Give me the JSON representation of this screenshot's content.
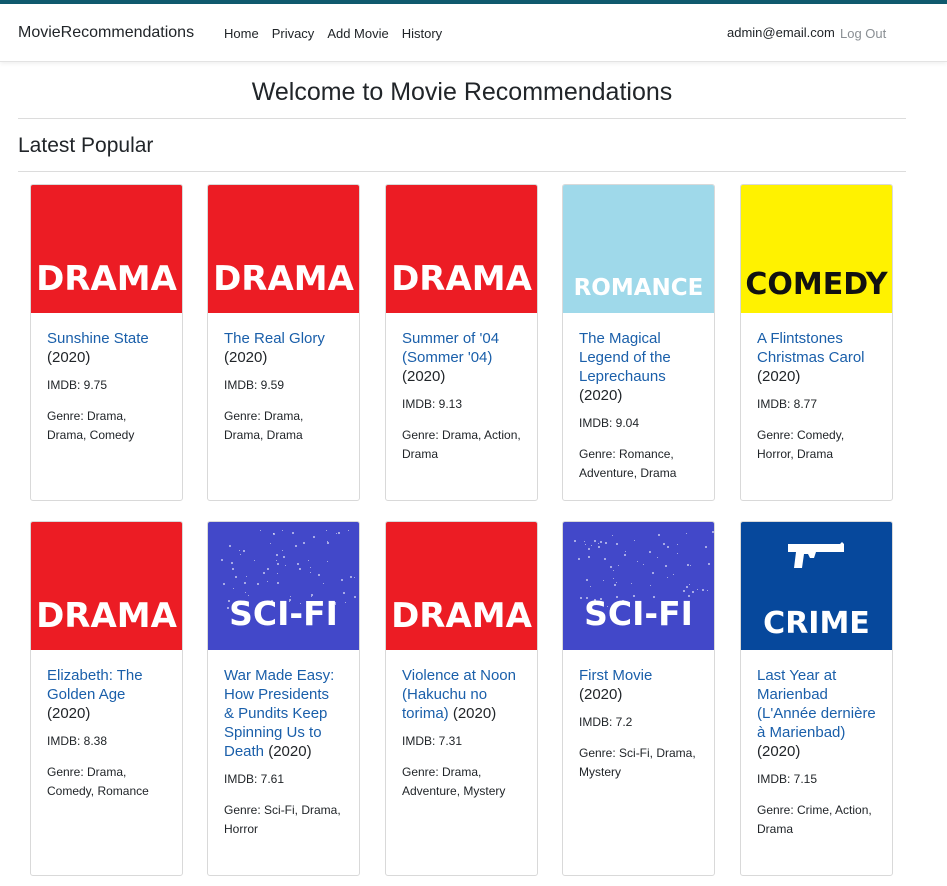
{
  "nav": {
    "brand": "MovieRecommendations",
    "links": [
      "Home",
      "Privacy",
      "Add Movie",
      "History"
    ],
    "user_email": "admin@email.com",
    "logout": "Log Out"
  },
  "page": {
    "welcome": "Welcome to Movie Recommendations",
    "section_title": "Latest Popular"
  },
  "colors": {
    "drama": "#ec1c24",
    "romance": "#9fd9ea",
    "comedy": "#fff200",
    "scifi": "#4248c9",
    "crime": "#06489c",
    "link": "#1a5faa"
  },
  "movies": [
    {
      "poster": "DRAMA",
      "title": "Sunshine State",
      "year": "(2020)",
      "imdb": "IMDB: 9.75",
      "genre": "Genre: Drama, Drama, Comedy"
    },
    {
      "poster": "DRAMA",
      "title": "The Real Glory",
      "year": "(2020)",
      "imdb": "IMDB: 9.59",
      "genre": "Genre: Drama, Drama, Drama"
    },
    {
      "poster": "DRAMA",
      "title": "Summer of '04 (Sommer '04)",
      "year": "(2020)",
      "imdb": "IMDB: 9.13",
      "genre": "Genre: Drama, Action, Drama"
    },
    {
      "poster": "ROMANCE",
      "title": "The Magical Legend of the Leprechauns",
      "year": "(2020)",
      "imdb": "IMDB: 9.04",
      "genre": "Genre: Romance, Adventure, Drama"
    },
    {
      "poster": "COMEDY",
      "title": "A Flintstones Christmas Carol",
      "year": "(2020)",
      "imdb": "IMDB: 8.77",
      "genre": "Genre: Comedy, Horror, Drama"
    },
    {
      "poster": "DRAMA",
      "title": "Elizabeth: The Golden Age",
      "year": "(2020)",
      "imdb": "IMDB: 8.38",
      "genre": "Genre: Drama, Comedy, Romance"
    },
    {
      "poster": "SCI-FI",
      "title": "War Made Easy: How Presidents & Pundits Keep Spinning Us to Death",
      "year": "(2020)",
      "imdb": "IMDB: 7.61",
      "genre": "Genre: Sci-Fi, Drama, Horror"
    },
    {
      "poster": "DRAMA",
      "title": "Violence at Noon (Hakuchu no torima)",
      "year": "(2020)",
      "imdb": "IMDB: 7.31",
      "genre": "Genre: Drama, Adventure, Mystery"
    },
    {
      "poster": "SCI-FI",
      "title": "First Movie",
      "year": "(2020)",
      "imdb": "IMDB: 7.2",
      "genre": "Genre: Sci-Fi, Drama, Mystery"
    },
    {
      "poster": "CRIME",
      "title": "Last Year at Marienbad (L'Année dernière à Marienbad)",
      "year": "(2020)",
      "imdb": "IMDB: 7.15",
      "genre": "Genre: Crime, Action, Drama"
    }
  ]
}
